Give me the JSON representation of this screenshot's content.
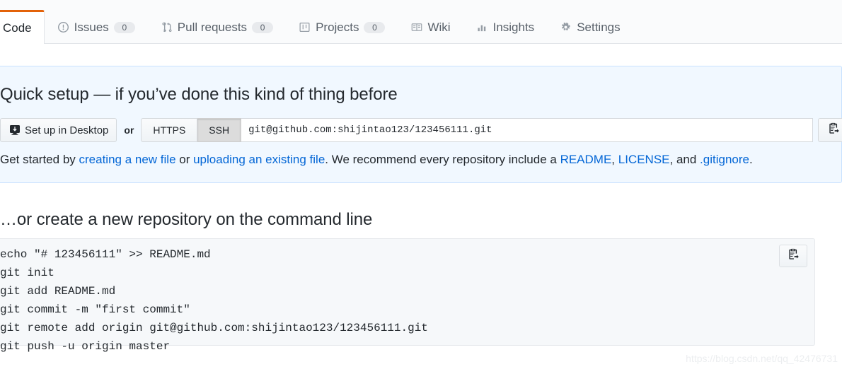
{
  "nav": {
    "tabs": [
      {
        "label": "Code",
        "icon": "code-icon",
        "count": null,
        "active": true
      },
      {
        "label": "Issues",
        "icon": "issue-opened-icon",
        "count": "0",
        "active": false
      },
      {
        "label": "Pull requests",
        "icon": "git-pull-request-icon",
        "count": "0",
        "active": false
      },
      {
        "label": "Projects",
        "icon": "project-board-icon",
        "count": "0",
        "active": false
      },
      {
        "label": "Wiki",
        "icon": "book-icon",
        "count": null,
        "active": false
      },
      {
        "label": "Insights",
        "icon": "graph-icon",
        "count": null,
        "active": false
      },
      {
        "label": "Settings",
        "icon": "gear-icon",
        "count": null,
        "active": false
      }
    ]
  },
  "quick_setup": {
    "title": "Quick setup — if you’ve done this kind of thing before",
    "desktop_button": "Set up in Desktop",
    "or_label": "or",
    "protocols": [
      {
        "label": "HTTPS",
        "selected": false
      },
      {
        "label": "SSH",
        "selected": true
      }
    ],
    "clone_url": "git@github.com:shijintao123/123456111.git",
    "copy_icon": "clipboard-copy-icon",
    "help": {
      "prefix": "Get started by ",
      "link_new_file": "creating a new file",
      "mid1": " or ",
      "link_upload": "uploading an existing file",
      "mid2": ". We recommend every repository include a ",
      "link_readme": "README",
      "sep1": ", ",
      "link_license": "LICENSE",
      "mid3": ", and ",
      "link_gitignore": ".gitignore",
      "suffix": "."
    }
  },
  "command_line": {
    "title": "…or create a new repository on the command line",
    "copy_icon": "clipboard-copy-icon",
    "commands": [
      "echo \"# 123456111\" >> README.md",
      "git init",
      "git add README.md",
      "git commit -m \"first commit\"",
      "git remote add origin git@github.com:shijintao123/123456111.git",
      "git push -u origin master"
    ]
  },
  "watermark": "https://blog.csdn.net/qq_42476731",
  "colors": {
    "active_tab_accent": "#e36209",
    "panel_bg": "#f1f8ff",
    "panel_border": "#c8e1ff",
    "link": "#0366d6",
    "code_bg": "#f6f8fa"
  }
}
